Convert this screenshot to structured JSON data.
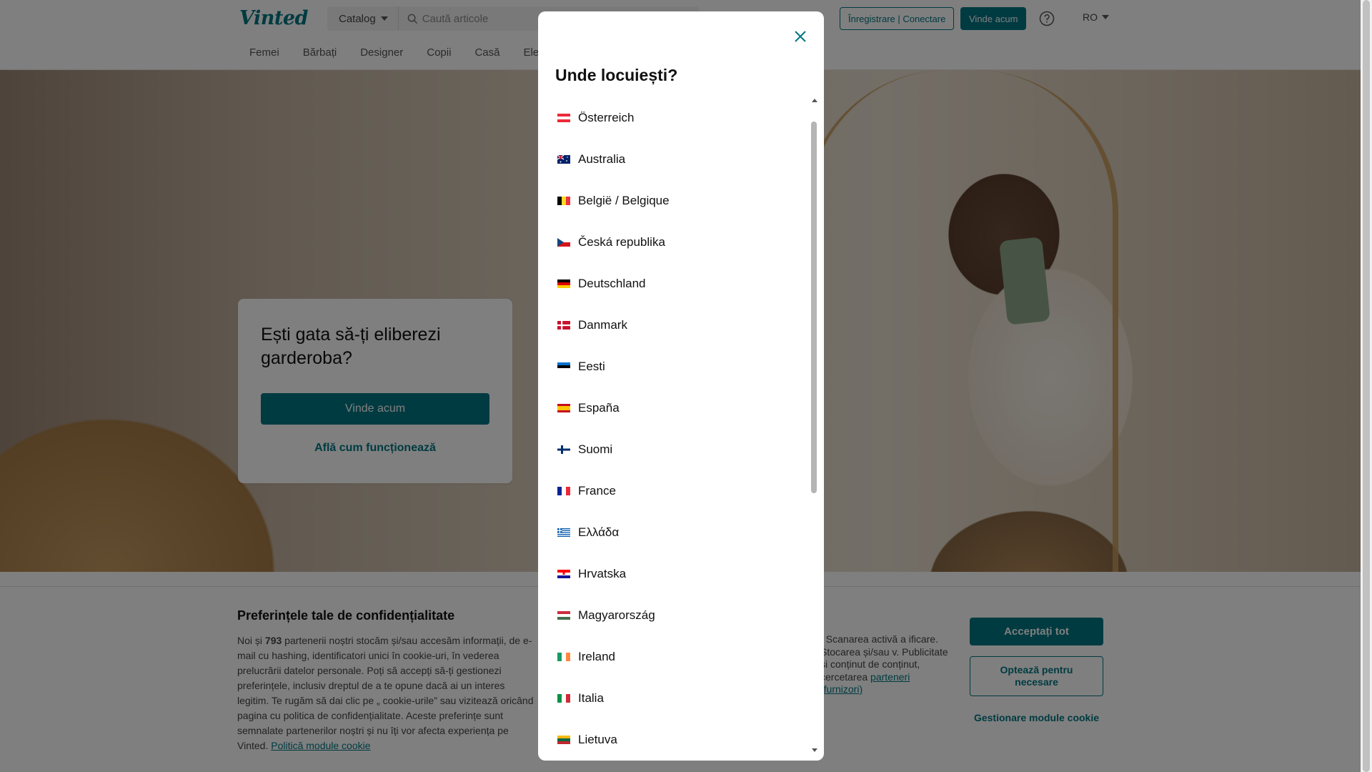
{
  "header": {
    "logo": "Vinted",
    "catalog_label": "Catalog",
    "search_placeholder": "Caută articole",
    "register_label": "Înregistrare | Conectare",
    "sell_label": "Vinde acum",
    "language": "RO",
    "nav": [
      "Femei",
      "Bărbați",
      "Designer",
      "Copii",
      "Casă",
      "Electronice"
    ]
  },
  "hero": {
    "title": "Ești gata să-ți eliberezi garderoba?",
    "sell_button": "Vinde acum",
    "how_link": "Află cum funcționează"
  },
  "cookie": {
    "title": "Preferințele tale de confidențialitate",
    "text_left_1": "Noi și ",
    "partners_count": "793",
    "text_left_2": " partenerii noștri stocăm și/sau accesăm informații, de e-mail cu hashing, identificatori unici în cookie-uri, în vederea prelucrării datelor personale. Poți să accepți să-ți gestionezi preferințele, inclusiv dreptul de a te opune dacă ai un interes legitim. Te rugăm să dai clic pe „ cookie-urile” sau vizitează oricând pagina cu politica de confidențialitate. Aceste preferințe sunt semnalate partenerilor noștri și nu îți vor afecta experiența pe Vinted. ",
    "policy_link": "Politică module cookie",
    "text_right": ". Scanarea activă a ificare. Stocarea și/sau v. Publicitate și conținut de conținut, cercetarea ",
    "partners_link": "parteneri (furnizori)",
    "accept_all": "Acceptați tot",
    "necessary_only": "Optează pentru necesare",
    "manage": "Gestionare module cookie"
  },
  "modal": {
    "title": "Unde locuiești?",
    "countries": [
      {
        "name": "Österreich",
        "flag": "austria-flag-icon"
      },
      {
        "name": "Australia",
        "flag": "australia-flag-icon"
      },
      {
        "name": "België / Belgique",
        "flag": "belgium-flag-icon"
      },
      {
        "name": "Česká republika",
        "flag": "czech-flag-icon"
      },
      {
        "name": "Deutschland",
        "flag": "germany-flag-icon"
      },
      {
        "name": "Danmark",
        "flag": "denmark-flag-icon"
      },
      {
        "name": "Eesti",
        "flag": "estonia-flag-icon"
      },
      {
        "name": "España",
        "flag": "spain-flag-icon"
      },
      {
        "name": "Suomi",
        "flag": "finland-flag-icon"
      },
      {
        "name": "France",
        "flag": "france-flag-icon"
      },
      {
        "name": "Ελλάδα",
        "flag": "greece-flag-icon"
      },
      {
        "name": "Hrvatska",
        "flag": "croatia-flag-icon"
      },
      {
        "name": "Magyarország",
        "flag": "hungary-flag-icon"
      },
      {
        "name": "Ireland",
        "flag": "ireland-flag-icon"
      },
      {
        "name": "Italia",
        "flag": "italy-flag-icon"
      },
      {
        "name": "Lietuva",
        "flag": "lithuania-flag-icon"
      }
    ]
  },
  "colors": {
    "brand": "#007782",
    "overlay": "rgba(0,0,0,0.5)"
  }
}
